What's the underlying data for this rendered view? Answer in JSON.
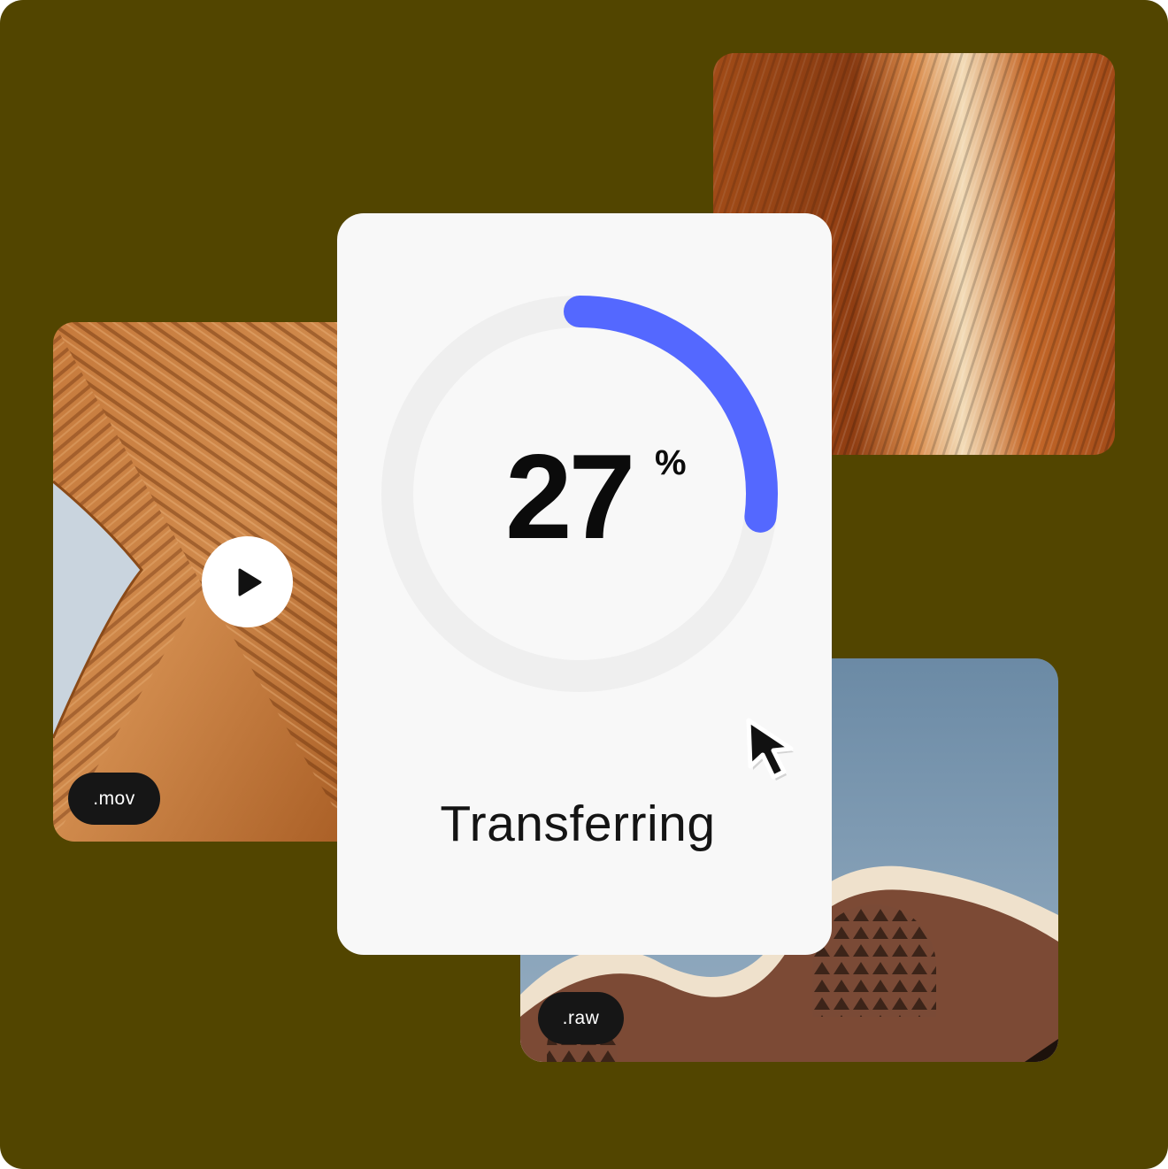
{
  "transfer": {
    "progress_percent": 27,
    "progress_value": "27",
    "percent_sign": "%",
    "status": "Transferring"
  },
  "files": [
    {
      "extension": ".mov",
      "kind": "video"
    },
    {
      "extension": ".raw",
      "kind": "image"
    }
  ],
  "colors": {
    "background": "#524500",
    "card": "#f8f8f8",
    "progress_accent": "#5468ff",
    "progress_track": "#efefef",
    "badge": "#161616"
  },
  "icons": [
    "play-icon",
    "cursor-arrow-icon"
  ]
}
